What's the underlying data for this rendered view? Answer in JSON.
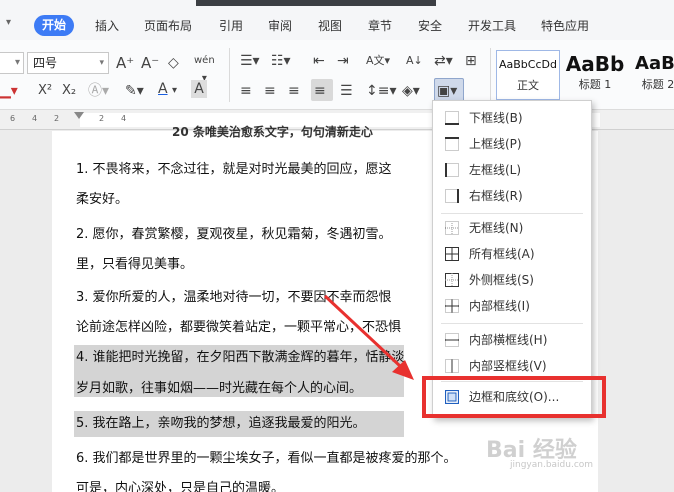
{
  "tabs": {
    "t0": "",
    "t1": "开始",
    "t2": "插入",
    "t3": "页面布局",
    "t4": "引用",
    "t5": "审阅",
    "t6": "视图",
    "t7": "章节",
    "t8": "安全",
    "t9": "开发工具",
    "t10": "特色应用"
  },
  "toolbar": {
    "font_size": "四号"
  },
  "styles": {
    "s0": {
      "sample": "AaBbCcDd",
      "name": "正文"
    },
    "s1": {
      "sample": "AaBb",
      "name": "标题 1"
    },
    "s2": {
      "sample": "AaBl",
      "name": "标题 2"
    }
  },
  "ruler": {
    "r0": "6",
    "r1": "4",
    "r2": "2",
    "r3": "2",
    "r4": "4"
  },
  "doc": {
    "title": "20 条唯美治愈系文字，句句清新走心",
    "l1": "1. 不畏将来，不念过往，就是对时光最美的回应，愿这",
    "l2": "柔安好。",
    "l3": "2. 愿你，春赏繁樱，夏观夜星，秋见霜菊，冬遇初雪。",
    "l4": "里，只看得见美事。",
    "l5": "3. 爱你所爱的人，温柔地对待一切，不要因不幸而怨恨",
    "l6": "论前途怎样凶险，都要微笑着站定，一颗平常心，不恐惧",
    "l7": "4. 谁能把时光挽留，在夕阳西下散满金辉的暮年，恬静淡",
    "l8": "岁月如歌，往事如烟——时光藏在每个人的心间。",
    "l9": "5. 我在路上，亲吻我的梦想，追逐我最爱的阳光。",
    "l10": "6. 我们都是世界里的一颗尘埃女子，看似一直都是被疼爱的那个。",
    "l11": "可是，内心深处，只是自己的温暖。"
  },
  "menu": {
    "m0": "下框线(B)",
    "m1": "上框线(P)",
    "m2": "左框线(L)",
    "m3": "右框线(R)",
    "m4": "无框线(N)",
    "m5": "所有框线(A)",
    "m6": "外侧框线(S)",
    "m7": "内部框线(I)",
    "m8": "内部横框线(H)",
    "m9": "内部竖框线(V)",
    "m10": "边框和底纹(O)..."
  },
  "watermark": {
    "logo": "Bai 经验",
    "url": "jingyan.baidu.com"
  },
  "colors": {
    "active_tab": "#3d7bf5",
    "annotation_red": "#e8312f",
    "selection_gray": "#d4d4d4"
  }
}
